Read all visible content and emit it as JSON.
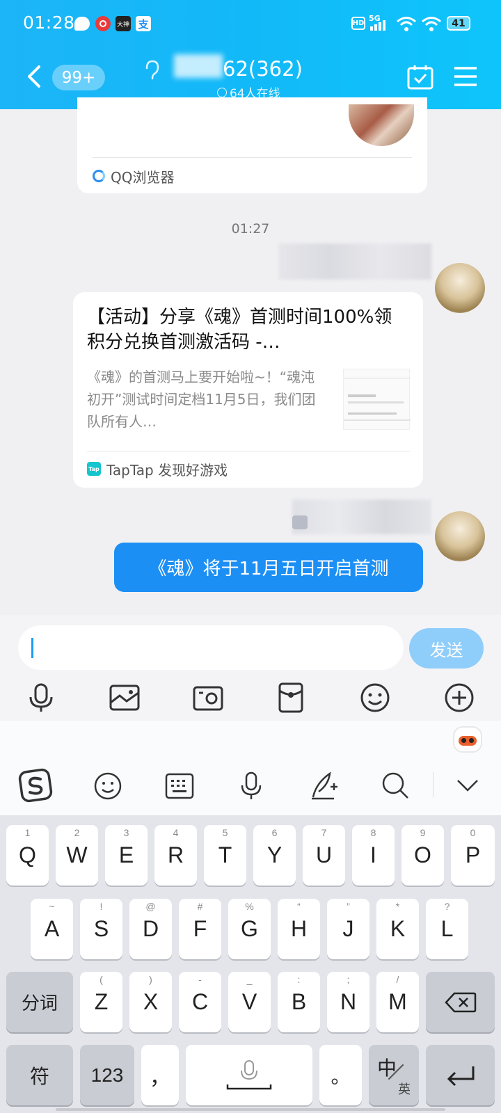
{
  "status_bar": {
    "time": "01:28",
    "battery": "41",
    "network": "5G",
    "hd": "HD"
  },
  "header": {
    "unread_badge": "99+",
    "group_title": "62(362)",
    "online_text": "64人在线"
  },
  "messages": {
    "link_card_top": {
      "source_label": "QQ浏览器"
    },
    "timestamp": "01:27",
    "article_card": {
      "title": "【活动】分享《魂》首测时间100%领积分兑换首测激活码 -…",
      "description": "《魂》的首测马上要开始啦~！“魂沌初开”测试时间定档11月5日，我们团队所有人…",
      "source_label": "TapTap 发现好游戏",
      "source_logo": "Tap"
    },
    "text_bubble": "《魂》将于11月五日开启首测"
  },
  "input": {
    "value": "",
    "send_label": "发送"
  },
  "toolbar_icons": [
    "microphone-icon",
    "photo-icon",
    "camera-icon",
    "red-packet-icon",
    "emoji-icon",
    "plus-icon"
  ],
  "keyboard_toolbar_icons": [
    "sogou-logo-icon",
    "emoji-icon",
    "keyboard-icon",
    "microphone-icon",
    "handwriting-icon",
    "search-icon",
    "collapse-icon"
  ],
  "keyboard": {
    "row1": [
      {
        "key": "Q",
        "hint": "1"
      },
      {
        "key": "W",
        "hint": "2"
      },
      {
        "key": "E",
        "hint": "3"
      },
      {
        "key": "R",
        "hint": "4"
      },
      {
        "key": "T",
        "hint": "5"
      },
      {
        "key": "Y",
        "hint": "6"
      },
      {
        "key": "U",
        "hint": "7"
      },
      {
        "key": "I",
        "hint": "8"
      },
      {
        "key": "O",
        "hint": "9"
      },
      {
        "key": "P",
        "hint": "0"
      }
    ],
    "row2": [
      {
        "key": "A",
        "hint": "~"
      },
      {
        "key": "S",
        "hint": "!"
      },
      {
        "key": "D",
        "hint": "@"
      },
      {
        "key": "F",
        "hint": "#"
      },
      {
        "key": "G",
        "hint": "%"
      },
      {
        "key": "H",
        "hint": "“"
      },
      {
        "key": "J",
        "hint": "”"
      },
      {
        "key": "K",
        "hint": "*"
      },
      {
        "key": "L",
        "hint": "?"
      }
    ],
    "row3": [
      {
        "key": "Z",
        "hint": "("
      },
      {
        "key": "X",
        "hint": ")"
      },
      {
        "key": "C",
        "hint": "-"
      },
      {
        "key": "V",
        "hint": "_"
      },
      {
        "key": "B",
        "hint": ":"
      },
      {
        "key": "N",
        "hint": ";"
      },
      {
        "key": "M",
        "hint": "/"
      }
    ],
    "segment_key": "分词",
    "symbol_key": "符",
    "num_key": "123",
    "comma_key": "，",
    "period_key": "。",
    "lang_key_main": "中",
    "lang_key_sub": "英"
  }
}
